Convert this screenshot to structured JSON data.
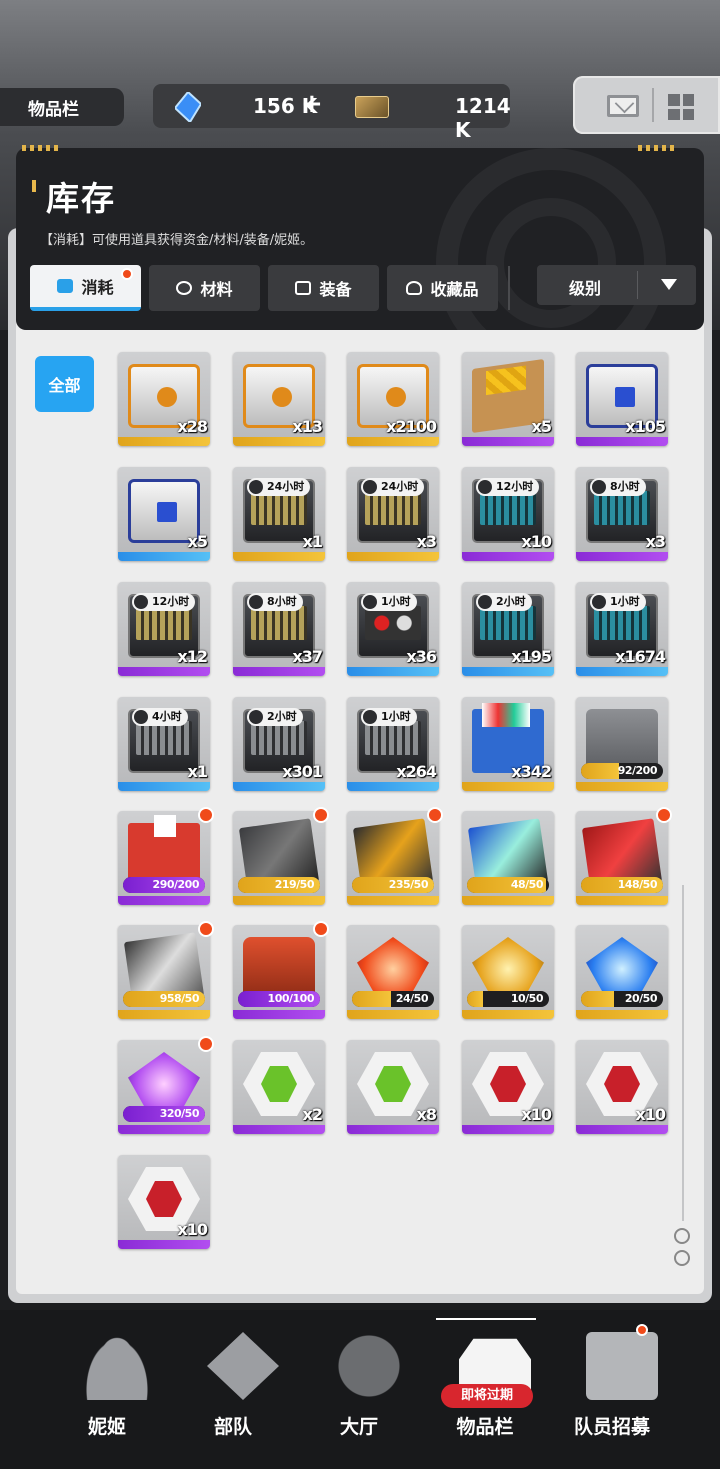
{
  "header": {
    "tag": "物品栏",
    "gems": "156 K",
    "plus": "+",
    "credits": "1214 K"
  },
  "panel": {
    "title": "库存",
    "subtitle": "【消耗】可使用道具获得资金/材料/装备/妮姬。"
  },
  "tabs": [
    {
      "label": "消耗",
      "icon": "consumable-icon",
      "active": true,
      "badge": true
    },
    {
      "label": "材料",
      "icon": "material-icon"
    },
    {
      "label": "装备",
      "icon": "equipment-icon"
    },
    {
      "label": "收藏品",
      "icon": "collectible-icon"
    }
  ],
  "sort": {
    "label": "级别"
  },
  "filter": {
    "all": "全部"
  },
  "items": [
    {
      "art": "crate o",
      "rarity": "gold",
      "qty": "x28"
    },
    {
      "art": "crate o",
      "rarity": "gold",
      "qty": "x13"
    },
    {
      "art": "crate o",
      "rarity": "gold",
      "qty": "x2100"
    },
    {
      "art": "box",
      "rarity": "purple",
      "qty": "x5"
    },
    {
      "art": "crate b",
      "rarity": "purple",
      "qty": "x105"
    },
    {
      "art": "crate b",
      "rarity": "blue",
      "qty": "x5"
    },
    {
      "art": "case y",
      "rarity": "gold",
      "qty": "x1",
      "timer": "24小时"
    },
    {
      "art": "case y",
      "rarity": "gold",
      "qty": "x3",
      "timer": "24小时"
    },
    {
      "art": "case",
      "rarity": "purple",
      "qty": "x10",
      "timer": "12小时"
    },
    {
      "art": "case",
      "rarity": "purple",
      "qty": "x3",
      "timer": "8小时"
    },
    {
      "art": "case y",
      "rarity": "purple",
      "qty": "x12",
      "timer": "12小时"
    },
    {
      "art": "case y",
      "rarity": "purple",
      "qty": "x37",
      "timer": "8小时"
    },
    {
      "art": "case r",
      "rarity": "blue",
      "qty": "x36",
      "timer": "1小时"
    },
    {
      "art": "case",
      "rarity": "blue",
      "qty": "x195",
      "timer": "2小时"
    },
    {
      "art": "case",
      "rarity": "blue",
      "qty": "x1674",
      "timer": "1小时"
    },
    {
      "art": "case g",
      "rarity": "blue",
      "qty": "x1",
      "timer": "4小时"
    },
    {
      "art": "case g",
      "rarity": "blue",
      "qty": "x301",
      "timer": "2小时"
    },
    {
      "art": "case g",
      "rarity": "blue",
      "qty": "x264",
      "timer": "1小时"
    },
    {
      "art": "bin",
      "rarity": "gold",
      "qty": "x342"
    },
    {
      "art": "mcase",
      "rarity": "gold",
      "progress": "92/200",
      "fill": 0.46,
      "pcolor": "gold"
    },
    {
      "art": "redbox",
      "rarity": "purple",
      "progress": "290/200",
      "fill": 1,
      "pcolor": "purple",
      "dot": true
    },
    {
      "art": "flyer k",
      "rarity": "gold",
      "progress": "219/50",
      "fill": 1,
      "pcolor": "gold",
      "dot": true
    },
    {
      "art": "flyer t",
      "rarity": "gold",
      "progress": "235/50",
      "fill": 1,
      "pcolor": "gold",
      "dot": true
    },
    {
      "art": "flyer e",
      "rarity": "gold",
      "progress": "48/50",
      "fill": 0.96,
      "pcolor": "gold"
    },
    {
      "art": "flyer m",
      "rarity": "gold",
      "progress": "148/50",
      "fill": 1,
      "pcolor": "gold",
      "dot": true
    },
    {
      "art": "flyer w",
      "rarity": "gold",
      "progress": "958/50",
      "fill": 1,
      "pcolor": "gold",
      "dot": true
    },
    {
      "art": "gear",
      "rarity": "purple",
      "progress": "100/100",
      "fill": 1,
      "pcolor": "purple",
      "dot": true
    },
    {
      "art": "shard o",
      "rarity": "gold",
      "progress": "24/50",
      "fill": 0.48,
      "pcolor": "gold"
    },
    {
      "art": "shard y",
      "rarity": "gold",
      "progress": "10/50",
      "fill": 0.2,
      "pcolor": "gold"
    },
    {
      "art": "shard b",
      "rarity": "gold",
      "progress": "20/50",
      "fill": 0.4,
      "pcolor": "gold"
    },
    {
      "art": "shard p",
      "rarity": "purple",
      "progress": "320/50",
      "fill": 1,
      "pcolor": "purple",
      "dot": true
    },
    {
      "art": "hex gr",
      "rarity": "purple",
      "qty": "x2"
    },
    {
      "art": "hex gr",
      "rarity": "purple",
      "qty": "x8"
    },
    {
      "art": "hex rd",
      "rarity": "purple",
      "qty": "x10"
    },
    {
      "art": "hex rd",
      "rarity": "purple",
      "qty": "x10"
    },
    {
      "art": "hex rd",
      "rarity": "purple",
      "qty": "x10"
    }
  ],
  "nav": [
    {
      "label": "妮姬",
      "icon": "people"
    },
    {
      "label": "部队",
      "icon": "squad"
    },
    {
      "label": "大厅",
      "icon": "hall"
    },
    {
      "label": "物品栏",
      "icon": "bag",
      "active": true
    },
    {
      "label": "队员招募",
      "icon": "recruit",
      "dot": true
    }
  ],
  "expire_badge": "即将过期"
}
